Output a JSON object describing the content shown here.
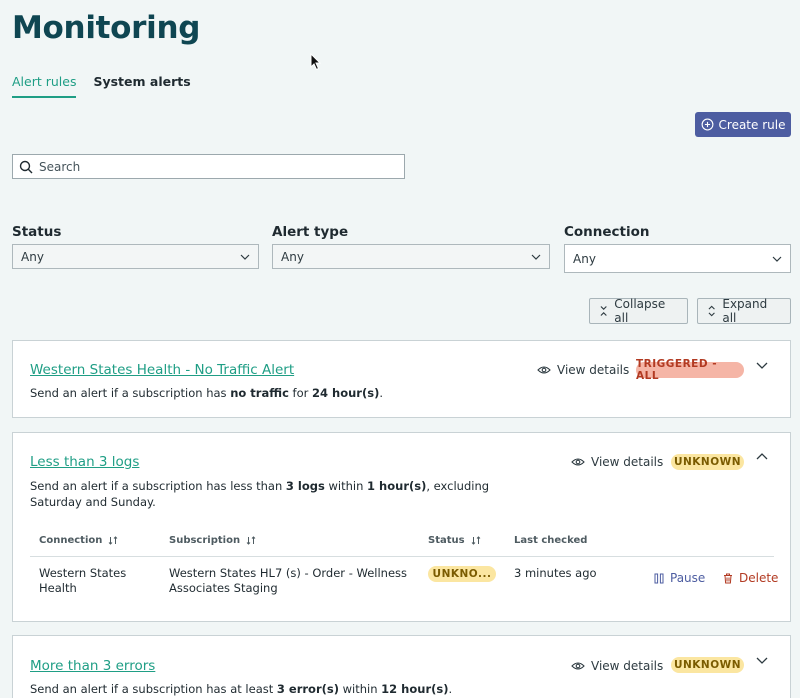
{
  "page": {
    "title": "Monitoring"
  },
  "tabs": [
    {
      "label": "Alert rules",
      "active": true
    },
    {
      "label": "System alerts",
      "active": false
    }
  ],
  "actions": {
    "create_rule": "Create rule",
    "collapse_all": "Collapse all",
    "expand_all": "Expand all"
  },
  "search": {
    "placeholder": "Search"
  },
  "filters": {
    "status": {
      "label": "Status",
      "value": "Any"
    },
    "alert_type": {
      "label": "Alert type",
      "value": "Any"
    },
    "connection": {
      "label": "Connection",
      "value": "Any"
    }
  },
  "rules": [
    {
      "title": "Western States Health - No Traffic Alert",
      "desc_pre": "Send an alert if a subscription has ",
      "desc_b1": "no traffic",
      "desc_mid": " for ",
      "desc_b2": "24 hour(s)",
      "desc_post": ".",
      "view_label": "View details",
      "badge": "TRIGGERED - ALL",
      "expanded": false
    },
    {
      "title": "Less than 3 logs",
      "desc_pre": "Send an alert if a subscription has less than ",
      "desc_b1": "3 logs",
      "desc_mid": " within ",
      "desc_b2": "1 hour(s)",
      "desc_post": ", excluding Saturday and Sunday.",
      "view_label": "View details",
      "badge": "UNKNOWN",
      "expanded": true,
      "table": {
        "columns": [
          "Connection",
          "Subscription",
          "Status",
          "Last checked"
        ],
        "rows": [
          {
            "connection": "Western States Health",
            "subscription": "Western States HL7 (s) - Order - Wellness Associates Staging",
            "status": "UNKNO...",
            "last_checked": "3 minutes ago",
            "pause_label": "Pause",
            "delete_label": "Delete"
          }
        ]
      }
    },
    {
      "title": "More than 3 errors",
      "desc_pre": "Send an alert if a subscription has at least ",
      "desc_b1": "3 error(s)",
      "desc_mid": " within ",
      "desc_b2": "12 hour(s)",
      "desc_post": ".",
      "view_label": "View details",
      "badge": "UNKNOWN",
      "expanded": false
    }
  ],
  "colors": {
    "accent": "#1f9e85",
    "primary": "#4d5da1",
    "title": "#0f4652",
    "danger": "#b23a22",
    "warning_bg": "#fbe6a1",
    "triggered_bg": "#f5b5a6"
  },
  "icons": [
    "mouse-cursor-icon",
    "plus-circle-icon",
    "search-icon",
    "chevron-down-icon",
    "chevron-up-icon",
    "collapse-icon",
    "expand-icon",
    "eye-icon",
    "sort-icon",
    "pause-icon",
    "trash-icon"
  ]
}
